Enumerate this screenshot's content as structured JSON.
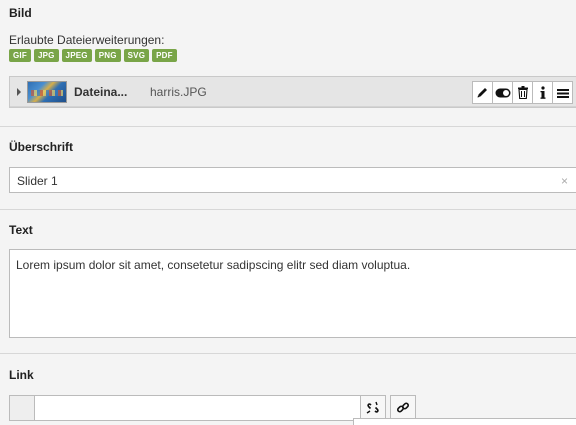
{
  "image_section": {
    "label": "Bild",
    "allowed_text": "Erlaubte Dateierweiterungen:",
    "extensions": [
      "GIF",
      "JPG",
      "JPEG",
      "PNG",
      "SVG",
      "PDF"
    ],
    "file": {
      "name": "Dateina...",
      "title": "harris.JPG"
    },
    "actions": [
      "edit-icon",
      "toggle-icon",
      "trash-icon",
      "info-icon",
      "menu-icon"
    ]
  },
  "heading_section": {
    "label": "Überschrift",
    "value": "Slider 1",
    "clear_glyph": "×"
  },
  "text_section": {
    "label": "Text",
    "value": "Lorem ipsum dolor sit amet, consetetur sadipscing elitr sed diam voluptua."
  },
  "link_section": {
    "label": "Link",
    "value": ""
  },
  "colors": {
    "badge": "#79a548",
    "background": "#f4f4f4"
  }
}
